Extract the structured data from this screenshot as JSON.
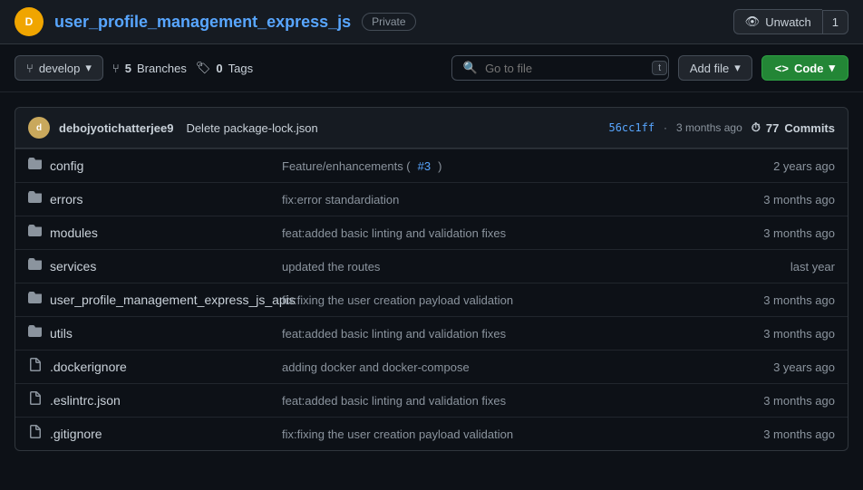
{
  "header": {
    "avatar_initials": "D",
    "repo_name": "user_profile_management_express_js",
    "badge": "Private",
    "unwatch_label": "Unwatch",
    "unwatch_count": "1"
  },
  "toolbar": {
    "branch_icon": "⑂",
    "branch_name": "develop",
    "branches_count": "5",
    "branches_label": "Branches",
    "tags_count": "0",
    "tags_label": "Tags",
    "search_placeholder": "Go to file",
    "search_key": "t",
    "add_file_label": "Add file",
    "code_label": "Code"
  },
  "commit_bar": {
    "avatar_initials": "d",
    "username": "debojyotichatterjee9",
    "message": "Delete package-lock.json",
    "hash": "56cc1ff",
    "time": "3 months ago",
    "commits_icon": "⏱",
    "commits_count": "77",
    "commits_label": "Commits"
  },
  "files": [
    {
      "type": "folder",
      "name": "config",
      "commit": "Feature/enhancements (#3)",
      "commit_link": "#3",
      "time": "2 years ago"
    },
    {
      "type": "folder",
      "name": "errors",
      "commit": "fix:error standardiation",
      "commit_link": null,
      "time": "3 months ago"
    },
    {
      "type": "folder",
      "name": "modules",
      "commit": "feat:added basic linting and validation fixes",
      "commit_link": null,
      "time": "3 months ago"
    },
    {
      "type": "folder",
      "name": "services",
      "commit": "updated the routes",
      "commit_link": null,
      "time": "last year"
    },
    {
      "type": "folder",
      "name": "user_profile_management_express_js_apis",
      "commit": "fix:fixing the user creation payload validation",
      "commit_link": null,
      "time": "3 months ago"
    },
    {
      "type": "folder",
      "name": "utils",
      "commit": "feat:added basic linting and validation fixes",
      "commit_link": null,
      "time": "3 months ago"
    },
    {
      "type": "file",
      "name": ".dockerignore",
      "commit": "adding docker and docker-compose",
      "commit_link": null,
      "time": "3 years ago"
    },
    {
      "type": "file",
      "name": ".eslintrc.json",
      "commit": "feat:added basic linting and validation fixes",
      "commit_link": null,
      "time": "3 months ago"
    },
    {
      "type": "file",
      "name": ".gitignore",
      "commit": "fix:fixing the user creation payload validation",
      "commit_link": null,
      "time": "3 months ago"
    }
  ]
}
